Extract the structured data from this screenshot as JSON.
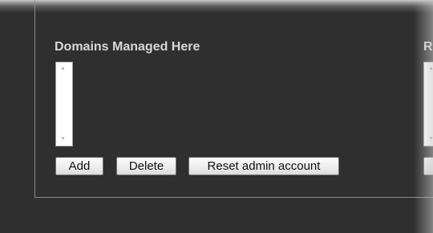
{
  "domains_section": {
    "title": "Domains Managed Here",
    "scroll_up_glyph": "▲",
    "scroll_down_glyph": "▼",
    "buttons": {
      "add": "Add",
      "delete": "Delete",
      "reset": "Reset admin account"
    }
  },
  "next_section": {
    "title_partial": "R",
    "scroll_up_glyph": "▲",
    "scroll_down_glyph": "▼"
  },
  "colors": {
    "background": "#2f2f2f",
    "title_text": "#d8d8d8",
    "panel_border": "#8a8a8a"
  }
}
